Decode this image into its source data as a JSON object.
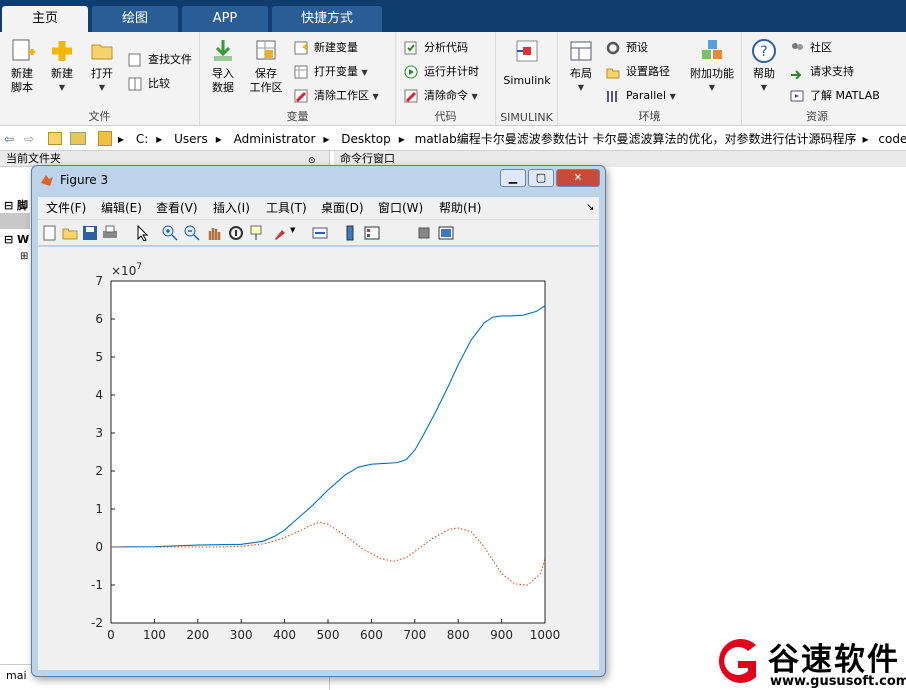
{
  "tabs": [
    "主页",
    "绘图",
    "APP",
    "快捷方式"
  ],
  "ribbon": {
    "file": {
      "name": "文件",
      "new_script": "新建\n脚本",
      "new": "新建",
      "open": "打开",
      "find_files": "查找文件",
      "compare": "比较"
    },
    "variable": {
      "name": "变量",
      "import": "导入\n数据",
      "save_ws": "保存\n工作区",
      "new_var": "新建变量",
      "open_var": "打开变量",
      "clear_ws": "清除工作区"
    },
    "code": {
      "name": "代码",
      "analyze": "分析代码",
      "run_time": "运行并计时",
      "clear_cmd": "清除命令"
    },
    "simulink": {
      "name": "SIMULINK",
      "label": "Simulink"
    },
    "env": {
      "name": "环境",
      "layout": "布局",
      "prefs": "预设",
      "set_path": "设置路径",
      "parallel": "Parallel",
      "addons": "附加功能"
    },
    "resources": {
      "name": "资源",
      "help": "帮助",
      "community": "社区",
      "support": "请求支持",
      "learn": "了解 MATLAB"
    }
  },
  "address": {
    "parts": [
      "C:",
      "Users",
      "Administrator",
      "Desktop",
      "matlab编程卡尔曼滤波参数估计 卡尔曼滤波算法的优化，对参数进行估计源码程序",
      "code"
    ]
  },
  "panels": {
    "current_folder": "当前文件夹",
    "command_window": "命令行窗口",
    "frag1": "脚",
    "frag2": "W",
    "frag3": "mai"
  },
  "figure": {
    "title": "Figure 3",
    "menus": [
      "文件(F)",
      "编辑(E)",
      "查看(V)",
      "插入(I)",
      "工具(T)",
      "桌面(D)",
      "窗口(W)",
      "帮助(H)"
    ]
  },
  "chart_data": {
    "type": "line",
    "title": "",
    "xlabel": "",
    "ylabel": "",
    "y_exponent_label": "×10^7",
    "xlim": [
      0,
      1000
    ],
    "ylim": [
      -2,
      7
    ],
    "xticks": [
      0,
      100,
      200,
      300,
      400,
      500,
      600,
      700,
      800,
      900,
      1000
    ],
    "yticks": [
      -2,
      -1,
      0,
      1,
      2,
      3,
      4,
      5,
      6,
      7
    ],
    "grid": false,
    "series": [
      {
        "style": "solid",
        "color": "#0072bd",
        "x": [
          0,
          100,
          200,
          250,
          300,
          350,
          380,
          400,
          430,
          460,
          500,
          540,
          570,
          600,
          630,
          660,
          680,
          700,
          720,
          750,
          780,
          800,
          830,
          860,
          880,
          900,
          920,
          950,
          980,
          1000
        ],
        "y": [
          0,
          0.01,
          0.05,
          0.06,
          0.07,
          0.15,
          0.3,
          0.45,
          0.75,
          1.05,
          1.5,
          1.9,
          2.1,
          2.18,
          2.2,
          2.22,
          2.3,
          2.55,
          2.95,
          3.6,
          4.3,
          4.8,
          5.45,
          5.9,
          6.05,
          6.08,
          6.08,
          6.1,
          6.2,
          6.35
        ]
      },
      {
        "style": "dotted",
        "color": "#d95319",
        "x": [
          0,
          100,
          200,
          250,
          300,
          350,
          380,
          400,
          430,
          460,
          480,
          500,
          540,
          580,
          620,
          650,
          680,
          700,
          740,
          780,
          800,
          830,
          860,
          880,
          900,
          930,
          960,
          990,
          1000
        ],
        "y": [
          0,
          0.0,
          0.0,
          0.0,
          0.02,
          0.08,
          0.17,
          0.25,
          0.4,
          0.57,
          0.65,
          0.6,
          0.3,
          -0.05,
          -0.3,
          -0.38,
          -0.28,
          -0.12,
          0.22,
          0.47,
          0.5,
          0.4,
          0.0,
          -0.35,
          -0.7,
          -0.97,
          -1.0,
          -0.7,
          -0.3
        ]
      }
    ]
  },
  "watermark": {
    "brand": "谷速软件",
    "url": "www.gususoft.com",
    "colors": {
      "brand": "#e0001b"
    }
  }
}
